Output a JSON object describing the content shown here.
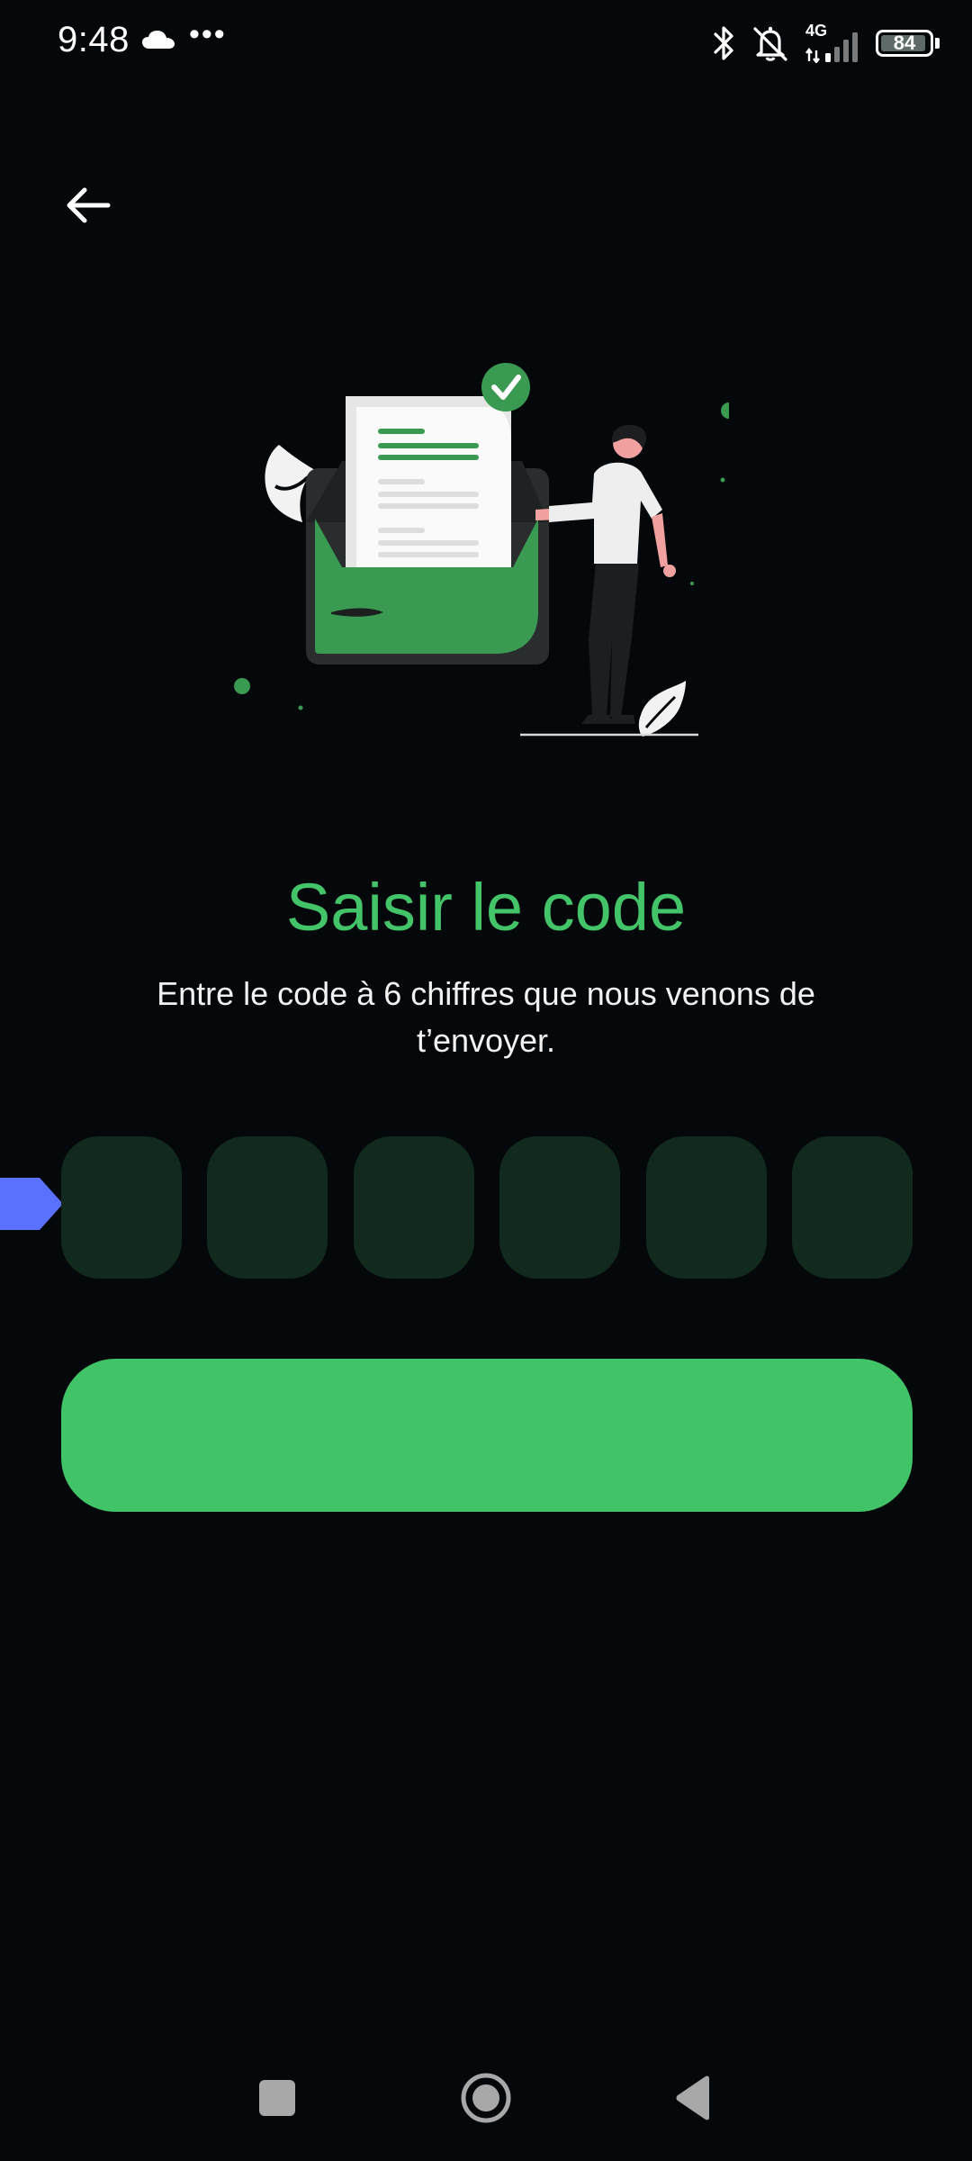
{
  "status_bar": {
    "time": "9:48",
    "more_indicator": "•••",
    "network_label": "4G",
    "battery_level": "84",
    "icons": [
      "cloud-icon",
      "bluetooth-icon",
      "muted-bell-icon",
      "signal-icon",
      "battery-icon"
    ]
  },
  "header": {
    "back_icon": "arrow-left-icon"
  },
  "main": {
    "title": "Saisir le code",
    "subtitle": "Entre le code à 6 chiffres que nous venons de t’envoyer.",
    "code": {
      "length": 6,
      "digits": [
        "",
        "",
        "",
        "",
        "",
        ""
      ]
    },
    "submit_label": ""
  },
  "nav_bar": {
    "icons": [
      "recent-apps-icon",
      "home-icon",
      "back-triangle-icon"
    ]
  },
  "colors": {
    "background": "#04080b",
    "accent_green": "#41c367",
    "title_green": "#43c468",
    "code_box": "#122a1d",
    "focus_marker": "#5a70ff"
  }
}
